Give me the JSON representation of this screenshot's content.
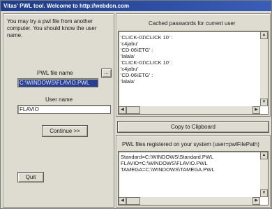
{
  "window": {
    "title": "Vitas' PWL tool. Welcome to http://webdon.com"
  },
  "left": {
    "intro": "You may try a pwl file from another computer. You should know the user name.",
    "pwl_label": "PWL file name",
    "pwl_value": "C:\\WINDOWS\\FLAVIO.PWL",
    "browse_label": "...",
    "user_label": "User name",
    "user_value": "FLAVIO",
    "continue_label": "Continue >>",
    "quit_label": "Quit"
  },
  "right": {
    "cached_title": "Cached passwords for current user",
    "cached_lines": [
      "'CLICK-01\\CLICK 10' :",
      "  'c4jabu'",
      "'CD-06\\ETG' :",
      "  'lalala'",
      "'CLICK-01\\CLICK 10' :",
      "  'c4jabu'",
      "'CD-06\\ETG' :",
      "  'lalala'"
    ],
    "copy_label": "Copy to Clipboard",
    "registered_title": "PWL files registered on your system (user=pwlFilePath)",
    "registered_lines": [
      "Standard=C:\\WINDOWS\\Standard.PWL",
      "FLAVIO=C:\\WINDOWS\\FLAVIO.PWL",
      "TAMEGA=C:\\WINDOWS\\TAMEGA.PWL"
    ]
  }
}
